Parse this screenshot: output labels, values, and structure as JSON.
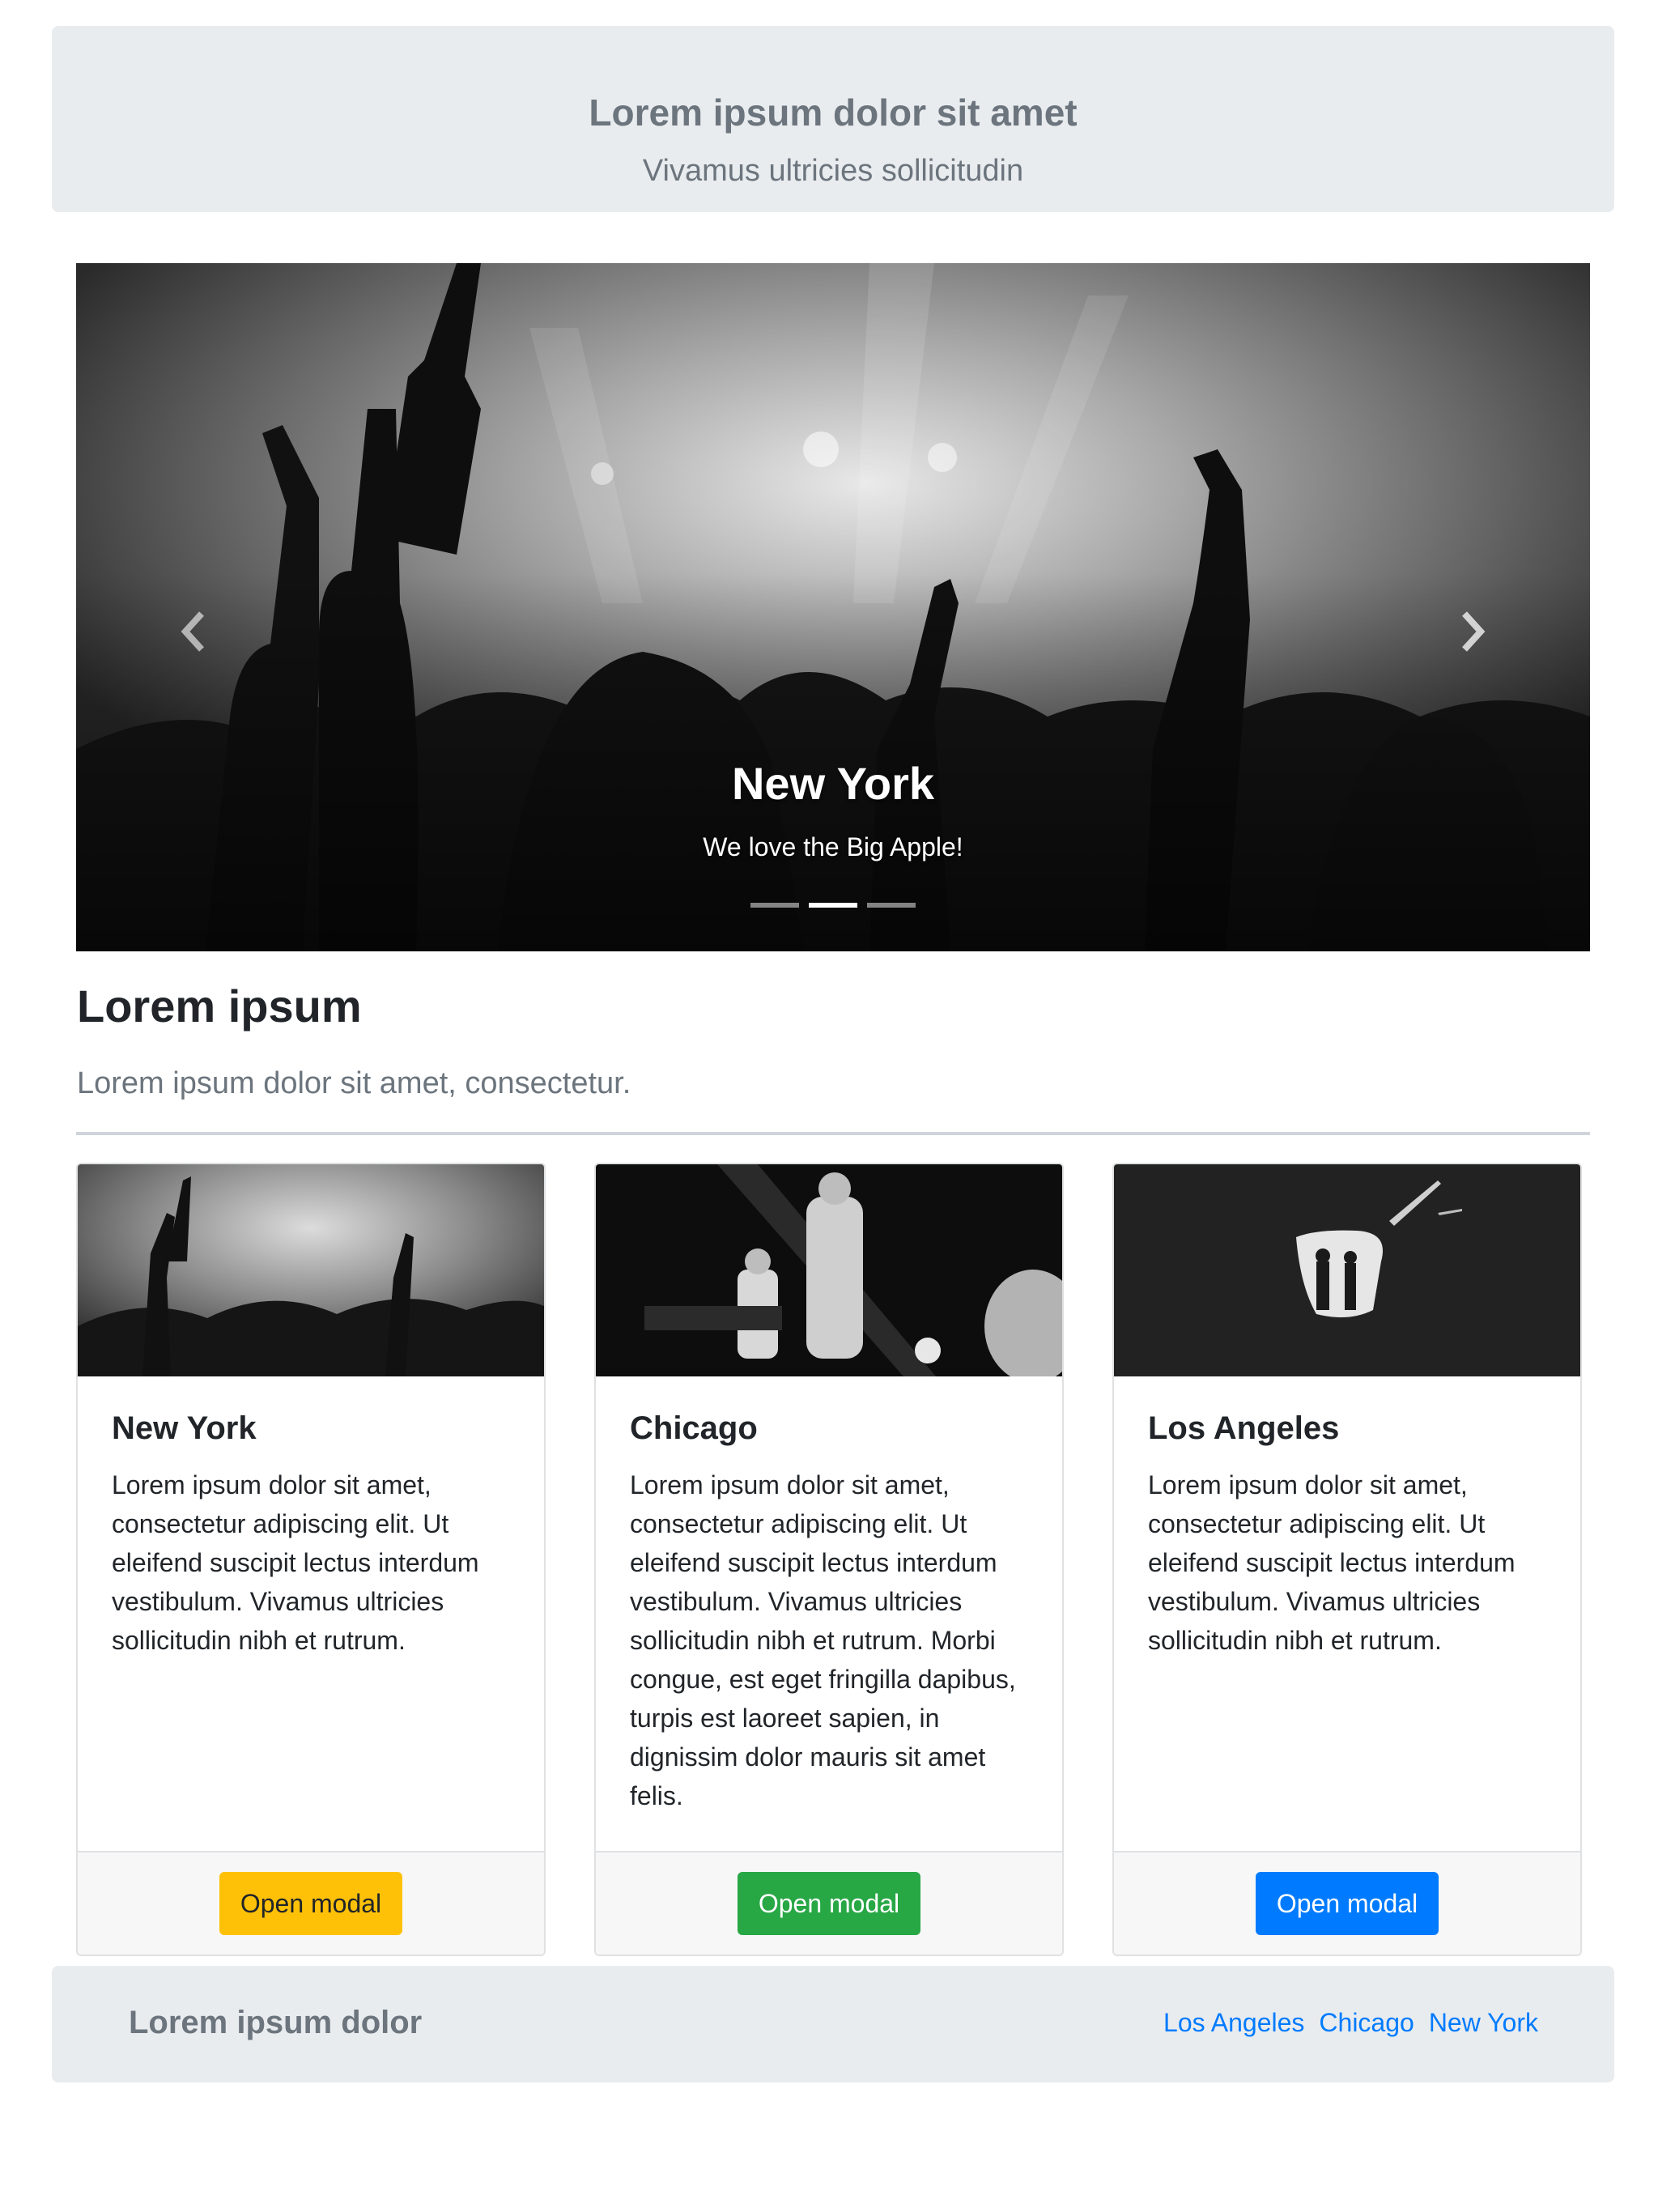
{
  "header": {
    "title": "Lorem ipsum dolor sit amet",
    "subtitle": "Vivamus ultricies sollicitudin"
  },
  "carousel": {
    "caption_title": "New York",
    "caption_text": "We love the Big Apple!",
    "slides_total": 3,
    "active_index": 1
  },
  "section": {
    "title": "Lorem ipsum",
    "lead": "Lorem ipsum dolor sit amet, consectetur."
  },
  "cards": [
    {
      "title": "New York",
      "text": "Lorem ipsum dolor sit amet, consectetur adipiscing elit. Ut eleifend suscipit lectus interdum vestibulum. Vivamus ultricies sollicitudin nibh et rutrum.",
      "button_label": "Open modal",
      "button_color": "#ffc107",
      "button_text_color": "#212529"
    },
    {
      "title": "Chicago",
      "text": "Lorem ipsum dolor sit amet, consectetur adipiscing elit. Ut eleifend suscipit lectus interdum vestibulum. Vivamus ultricies sollicitudin nibh et rutrum. Morbi congue, est eget fringilla dapibus, turpis est laoreet sapien, in dignissim dolor mauris sit amet felis.",
      "button_label": "Open modal",
      "button_color": "#28a745",
      "button_text_color": "#ffffff"
    },
    {
      "title": "Los Angeles",
      "text": "Lorem ipsum dolor sit amet, consectetur adipiscing elit. Ut eleifend suscipit lectus interdum vestibulum. Vivamus ultricies sollicitudin nibh et rutrum.",
      "button_label": "Open modal",
      "button_color": "#007bff",
      "button_text_color": "#ffffff"
    }
  ],
  "footer": {
    "brand": "Lorem ipsum dolor",
    "links": [
      "Los Angeles",
      "Chicago",
      "New York"
    ],
    "link_color": "#007bff"
  },
  "icons": {
    "prev": "chevron-left-icon",
    "next": "chevron-right-icon"
  }
}
